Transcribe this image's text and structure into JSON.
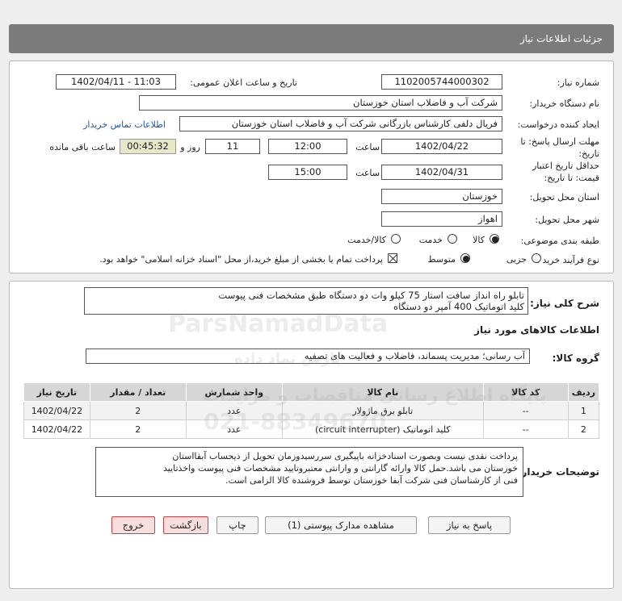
{
  "header": {
    "title": "جزئیات اطلاعات نیاز"
  },
  "fields": {
    "need_number_label": "شماره نیاز:",
    "need_number": "1102005744000302",
    "announce_label": "تاریخ و ساعت اعلان عمومی:",
    "announce_value": "1402/04/11 - 11:03",
    "buyer_org_label": "نام دستگاه خریدار:",
    "buyer_org": "شرکت آب و فاضلاب استان خوزستان",
    "creator_label": "ایجاد کننده درخواست:",
    "creator": "فریال دلفی کارشناس بازرگانی شرکت آب و فاضلاب استان خوزستان",
    "contact_link": "اطلاعات تماس خریدار",
    "deadline_label": "مهلت ارسال پاسخ: تا تاریخ:",
    "deadline_date": "1402/04/22",
    "time_label": "ساعت",
    "deadline_time": "12:00",
    "days_value": "11",
    "days_label": "روز و",
    "remaining_time": "00:45:32",
    "remaining_label": "ساعت باقی مانده",
    "validity_label": "حداقل تاریخ اعتبار قیمت: تا تاریخ:",
    "validity_date": "1402/04/31",
    "validity_time": "15:00",
    "province_label": "استان محل تحویل:",
    "province": "خوزستان",
    "city_label": "شهر محل تحویل:",
    "city": "اهواز",
    "category_label": "طبقه بندی موضوعی:",
    "category_options": [
      "کالا",
      "خدمت",
      "کالا/خدمت"
    ],
    "process_label": "نوع فرآیند خرید :",
    "process_options": [
      "جزیی",
      "متوسط"
    ],
    "payment_note": "پرداخت تمام یا بخشی از مبلغ خرید،از محل \"اسناد خزانه اسلامی\" خواهد بود."
  },
  "description": {
    "label": "شرح کلی نیاز:",
    "line1": "تابلو راه انداز سافت استار 75 کیلو وات دو دستگاه طبق مشخصات فنی پیوست",
    "line2": "کلید اتوماتیک 400 آمپر دو دستگاه"
  },
  "goods": {
    "section_title": "اطلاعات کالاهای مورد نیاز",
    "group_label": "گروه کالا:",
    "group_value": "آب رسانی؛ مدیریت پسماند، فاضلاب و فعالیت های تصفیه",
    "columns": [
      "ردیف",
      "کد کالا",
      "نام کالا",
      "واحد شمارش",
      "تعداد / مقدار",
      "تاریخ نیاز"
    ],
    "rows": [
      {
        "row": "1",
        "code": "--",
        "name": "تابلو برق ماژولار",
        "unit": "عدد",
        "qty": "2",
        "date": "1402/04/22"
      },
      {
        "row": "2",
        "code": "--",
        "name": "کلید اتوماتیک (circuit interrupter)",
        "unit": "عدد",
        "qty": "2",
        "date": "1402/04/22"
      }
    ]
  },
  "buyer_notes": {
    "label": "توضیحات خریدار:",
    "line1": "پرداخت نقدی نیست وبصورت اسنادخزانه باپیگیری سررسیدوزمان تحویل از ذیحساب آبفااستان",
    "line2": "خوزستان می باشد.حمل کالا وارائه گارانتی و وارانتی معتبروتایید مشخصات فنی پیوست واخذتایید",
    "line3": "فنی از کارشناسان فنی شرکت آبفا خوزستان توسط فروشنده کالا الزامی است."
  },
  "buttons": {
    "reply": "پاسخ به نیاز",
    "attachments": "مشاهده مدارک پیوستی (1)",
    "print": "چاپ",
    "back": "بازگشت",
    "exit": "خروج"
  },
  "watermark": {
    "brand": "ParsNamadData",
    "phone": "021-88349670",
    "line1": "پایگاه اطلاع رسانی مناقصات و مزایدات",
    "line2": "پارس نماد داده"
  }
}
